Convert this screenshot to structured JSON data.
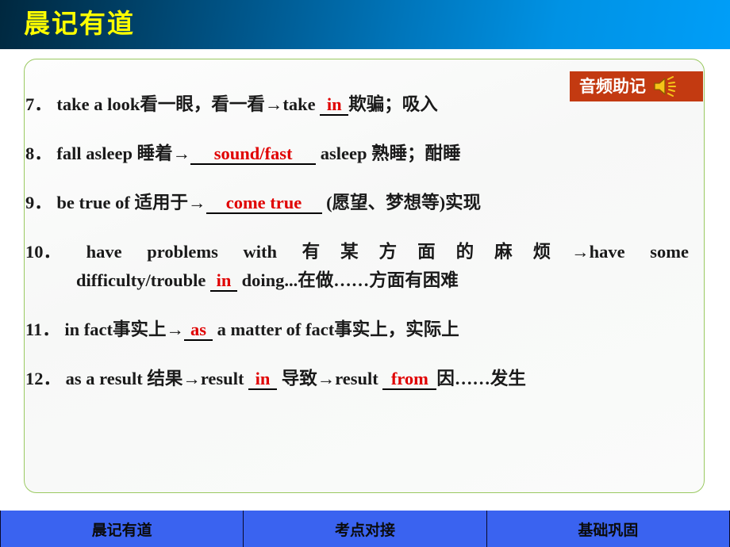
{
  "header": {
    "title": "晨记有道",
    "title_color": "#ffff00",
    "gradient_from": "#00283f",
    "gradient_to": "#009ef8"
  },
  "audio_badge": {
    "label": "音频助记",
    "icon": "speaker-icon",
    "background_color": "#c33a11",
    "text_color": "#ffffff"
  },
  "panel": {
    "border_color": "#9ac961",
    "background_color": "#fafbfa"
  },
  "blank_color": "#e00000",
  "entries": [
    {
      "number": "7．",
      "pre": "take a look看一眼，看一看→take ",
      "blank": "in",
      "post": "欺骗；吸入"
    },
    {
      "number": "8．",
      "pre": "fall asleep 睡着→",
      "blank": "sound/fast",
      "post": " asleep 熟睡；酣睡"
    },
    {
      "number": "9．",
      "pre": "be true of 适用于→",
      "blank": "come true",
      "post": " (愿望、梦想等)实现"
    },
    {
      "number": "10．",
      "line1_words": [
        "have",
        "problems",
        "with",
        "有某方面的麻烦→have",
        "some"
      ],
      "line2_pre": "difficulty/trouble ",
      "blank": "in",
      "line2_post": " doing...在做……方面有困难"
    },
    {
      "number": "11．",
      "pre": "in fact事实上→",
      "blank": "as",
      "post": " a matter of fact事实上，实际上"
    },
    {
      "number": "12．",
      "pre": "as a result 结果→result ",
      "blank": "in",
      "mid": " 导致→result ",
      "blank2": "from",
      "post": "因……发生"
    }
  ],
  "footer": {
    "background_color": "#3a63f0",
    "tabs": [
      {
        "label": "晨记有道"
      },
      {
        "label": "考点对接"
      },
      {
        "label": "基础巩固"
      }
    ]
  }
}
